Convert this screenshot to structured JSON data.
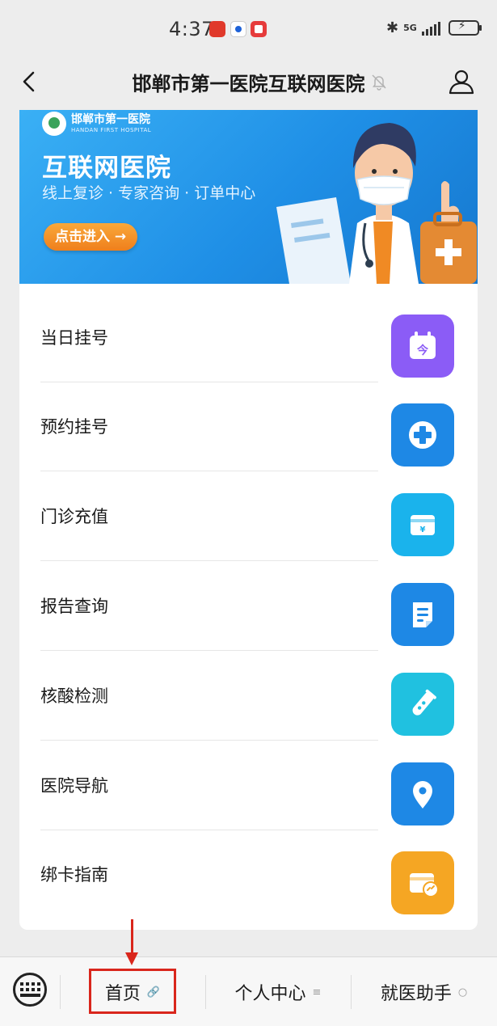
{
  "status_bar": {
    "time": "4:37",
    "network": "5G",
    "colors": {
      "badge_red": "#e0392b",
      "badge_blue": "#1e62d8"
    }
  },
  "title_bar": {
    "title": "邯郸市第一医院互联网医院",
    "icons": [
      "chevron-left-icon",
      "bell-off-icon",
      "user-icon"
    ]
  },
  "banner": {
    "logo_name": "邯郸市第一医院",
    "logo_en": "HANDAN FIRST HOSPITAL",
    "title": "互联网医院",
    "subtitle": "线上复诊 · 专家咨询 · 订单中心",
    "button": "点击进入 →",
    "colors": {
      "background": "#2196f0",
      "button": "#f29126"
    }
  },
  "menu": {
    "items": [
      {
        "label": "当日挂号",
        "icon": "today-calendar-icon",
        "color": "#8b5cf6"
      },
      {
        "label": "预约挂号",
        "icon": "medical-cross-icon",
        "color": "#1e88e5"
      },
      {
        "label": "门诊充值",
        "icon": "wallet-yen-icon",
        "color": "#1ab3ec"
      },
      {
        "label": "报告查询",
        "icon": "report-document-icon",
        "color": "#1e88e5"
      },
      {
        "label": "核酸检测",
        "icon": "test-tube-icon",
        "color": "#20c1e0"
      },
      {
        "label": "医院导航",
        "icon": "location-pin-icon",
        "color": "#1e88e5"
      },
      {
        "label": "绑卡指南",
        "icon": "card-link-icon",
        "color": "#f5a623"
      }
    ]
  },
  "bottom_bar": {
    "tabs": [
      {
        "label": "首页",
        "glyph": "🔗"
      },
      {
        "label": "个人中心",
        "glyph": "≡"
      },
      {
        "label": "就医助手",
        "glyph": "○"
      }
    ],
    "annotation_color": "#d9261c"
  }
}
